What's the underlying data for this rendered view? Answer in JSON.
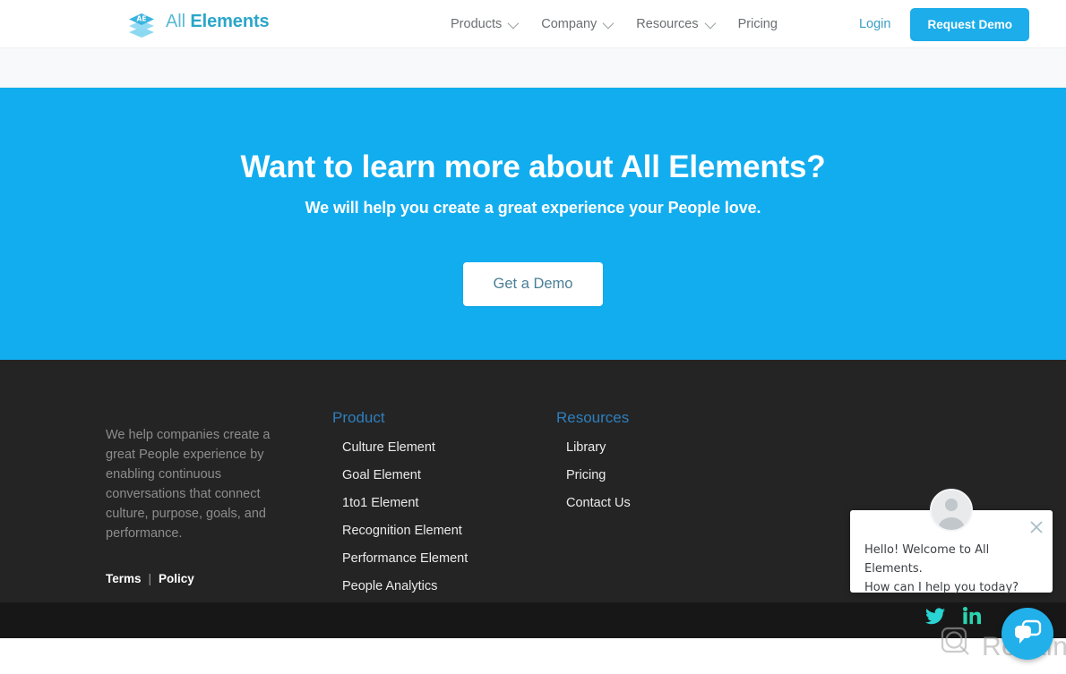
{
  "header": {
    "brand": {
      "name_first": "All",
      "name_second": "Elements",
      "logo_icon": "stacked-layers-ae-icon"
    },
    "nav": [
      {
        "label": "Products",
        "has_dropdown": true
      },
      {
        "label": "Company",
        "has_dropdown": true
      },
      {
        "label": "Resources",
        "has_dropdown": true
      },
      {
        "label": "Pricing",
        "has_dropdown": false
      }
    ],
    "login_label": "Login",
    "demo_button_label": "Request Demo"
  },
  "hero": {
    "title": "Want to learn more about All Elements?",
    "subtitle": "We will help you create a great experience your People love.",
    "cta_label": "Get a Demo",
    "background_color": "#12adef"
  },
  "footer": {
    "about_text": "We help companies create a great People experience by enabling continuous conversations that connect culture, purpose, goals, and performance.",
    "legal": {
      "terms_label": "Terms",
      "separator": "|",
      "policy_label": "Policy"
    },
    "columns": [
      {
        "title": "Product",
        "links": [
          "Culture Element",
          "Goal Element",
          "1to1 Element",
          "Recognition Element",
          "Performance Element",
          "People Analytics"
        ]
      },
      {
        "title": "Resources",
        "links": [
          "Library",
          "Pricing",
          "Contact Us"
        ]
      }
    ],
    "social": [
      {
        "name": "twitter-icon",
        "color": "#2ad4d4"
      },
      {
        "name": "linkedin-icon",
        "color": "#2ad4b0"
      }
    ],
    "background_color": "#242424",
    "heading_color": "#2f7fbd"
  },
  "chat": {
    "message_line1": "Hello! Welcome to All Elements.",
    "message_line2": "How can I help you today?",
    "avatar_icon": "person-avatar-icon",
    "close_icon": "close-icon",
    "launcher_icon": "chat-bubbles-icon",
    "launcher_color": "#21b0ea"
  },
  "watermark": {
    "text": "Revain",
    "logo_icon": "revain-logo-icon"
  }
}
